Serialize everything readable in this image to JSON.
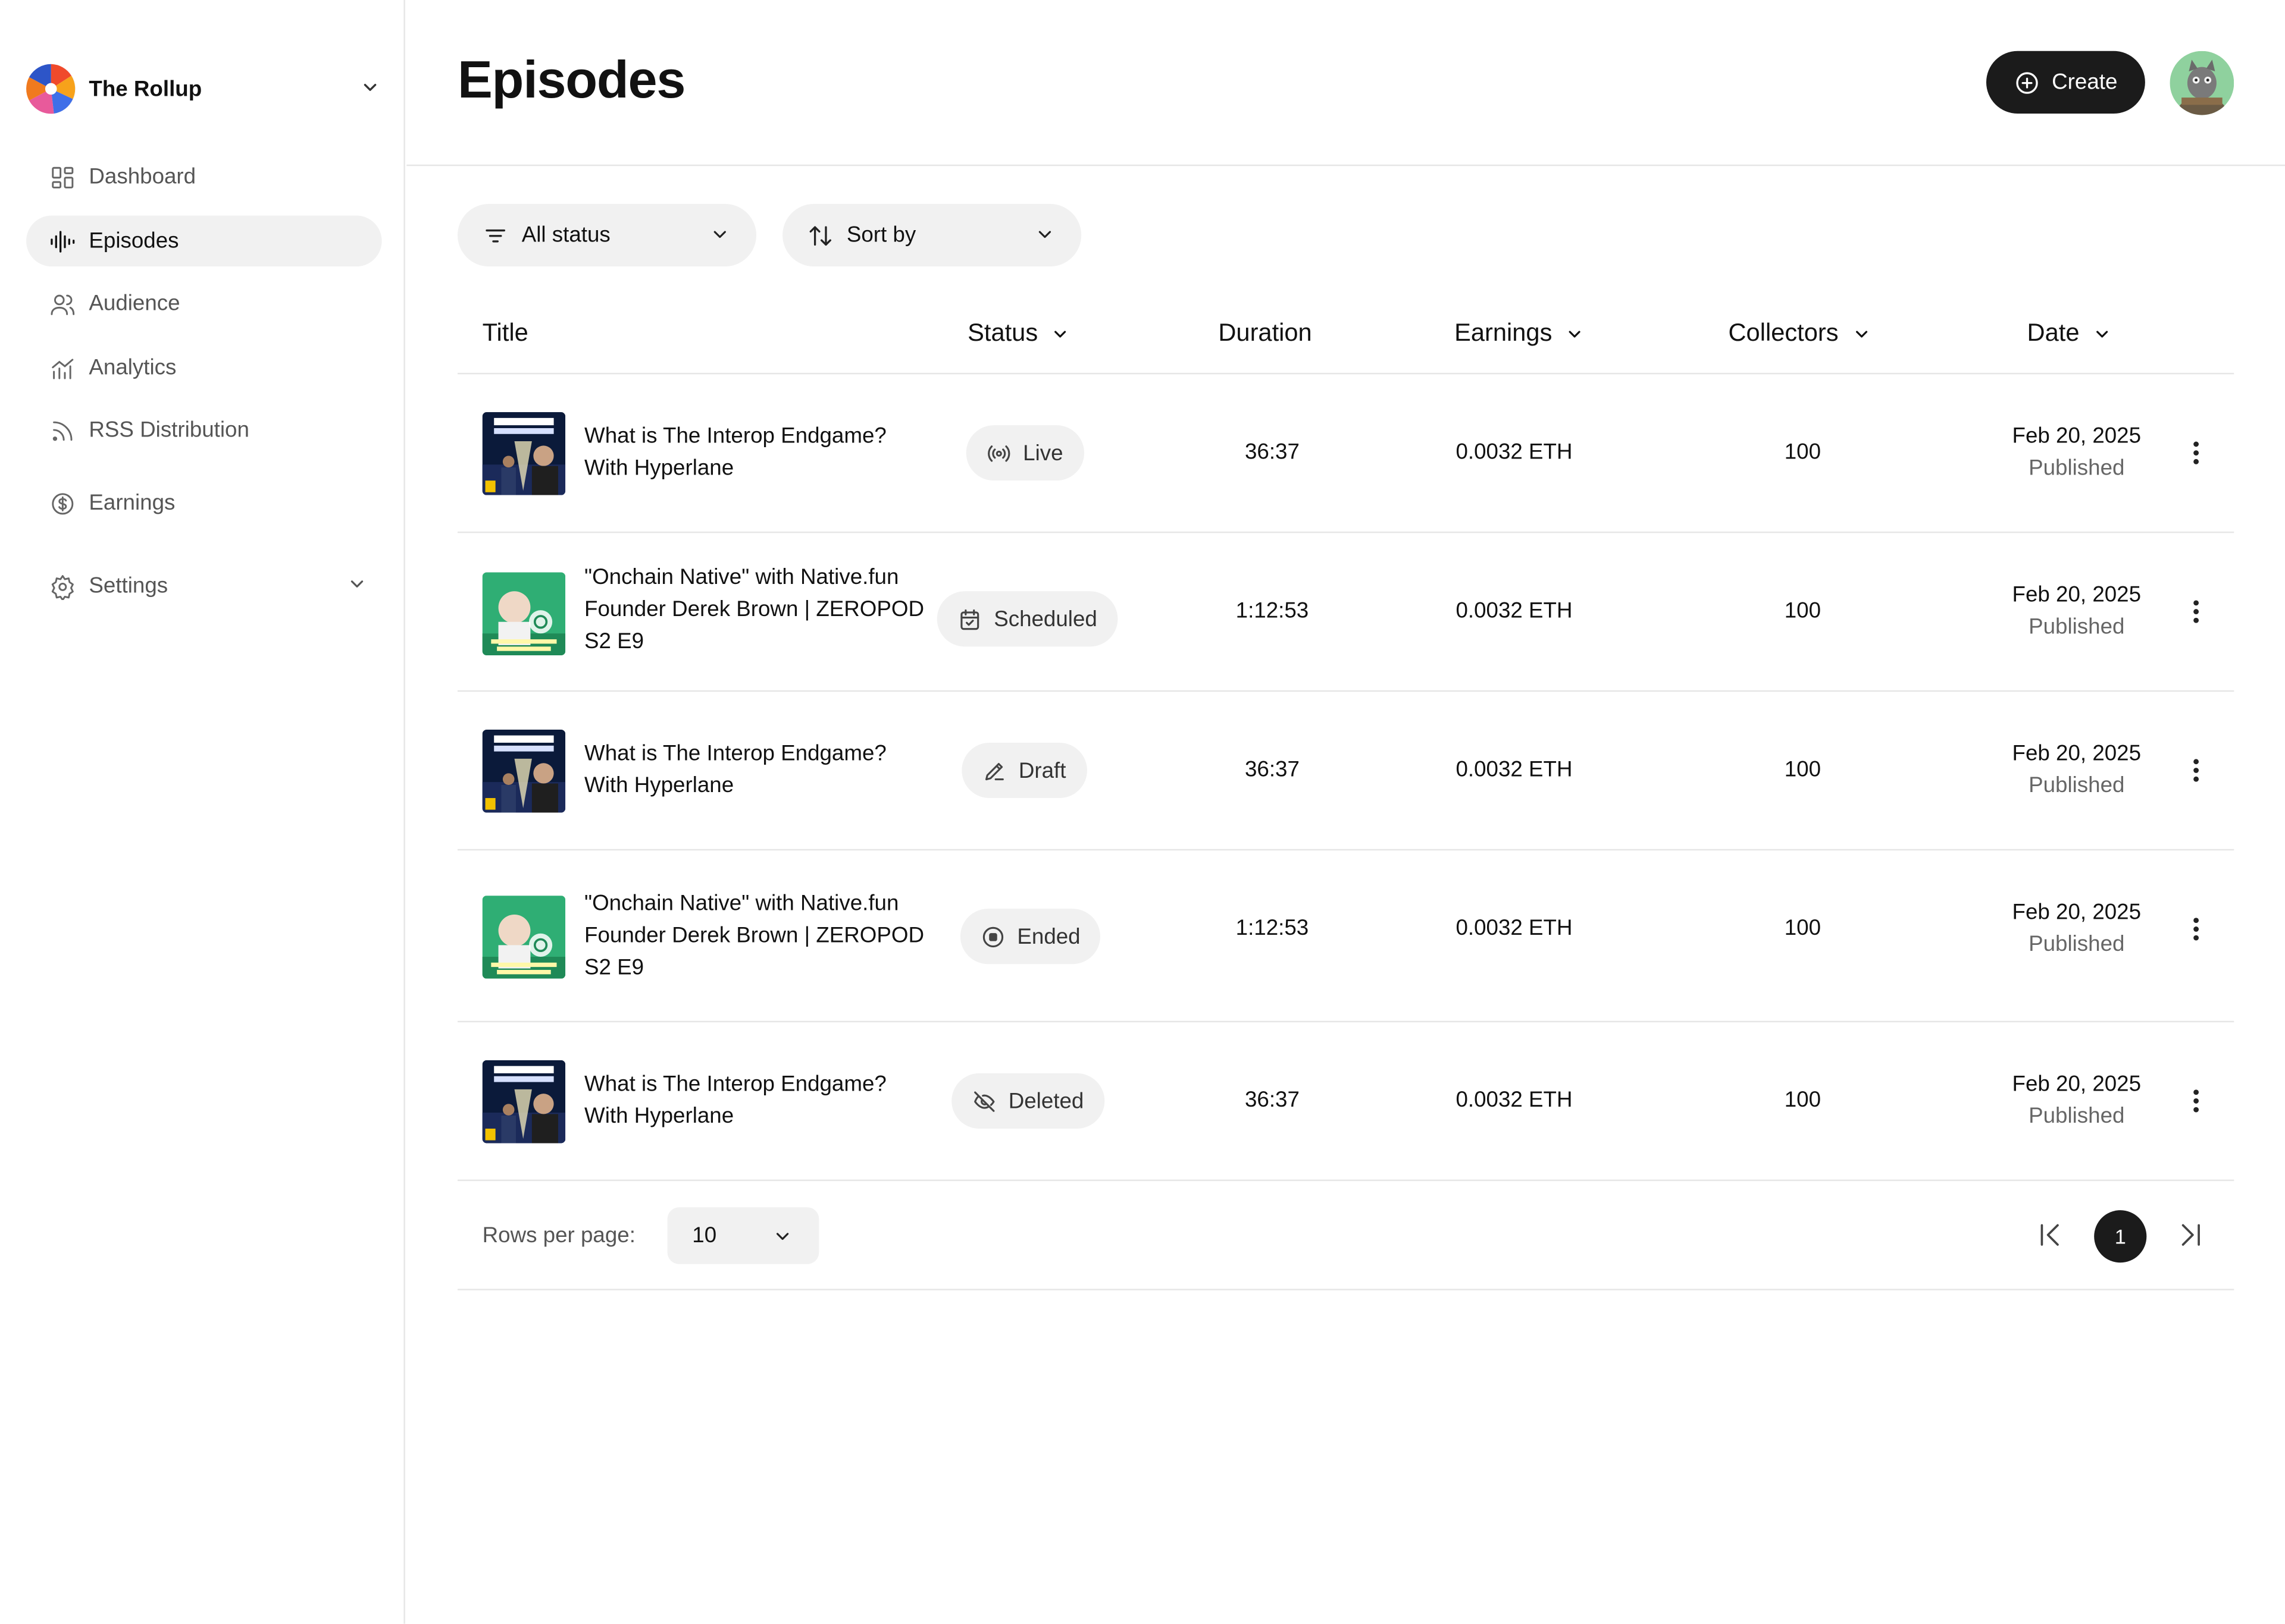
{
  "workspace": {
    "name": "The Rollup"
  },
  "sidebar": {
    "items": [
      {
        "label": "Dashboard",
        "icon": "dashboard-grid-icon"
      },
      {
        "label": "Episodes",
        "icon": "audio-waveform-icon"
      },
      {
        "label": "Audience",
        "icon": "users-icon"
      },
      {
        "label": "Analytics",
        "icon": "chart-bars-icon"
      },
      {
        "label": "RSS Distribution",
        "icon": "rss-icon"
      },
      {
        "label": "Earnings",
        "icon": "dollar-circle-icon"
      },
      {
        "label": "Settings",
        "icon": "gear-icon"
      }
    ]
  },
  "header": {
    "title": "Episodes",
    "create_label": "Create"
  },
  "filters": {
    "status": "All status",
    "sort": "Sort by"
  },
  "table": {
    "columns": [
      "Title",
      "Status",
      "Duration",
      "Earnings",
      "Collectors",
      "Date"
    ],
    "rows": [
      {
        "title": "What is The Interop Endgame? With Hyperlane",
        "thumb": "interop",
        "status": "Live",
        "status_icon": "broadcast-icon",
        "duration": "36:37",
        "earnings": "0.0032 ETH",
        "collectors": "100",
        "date": "Feb 20, 2025",
        "state": "Published"
      },
      {
        "title": "\"Onchain Native\" with Native.fun Founder Derek Brown | ZEROPOD S2 E9",
        "thumb": "zeropod",
        "status": "Scheduled",
        "status_icon": "calendar-check-icon",
        "duration": "1:12:53",
        "earnings": "0.0032 ETH",
        "collectors": "100",
        "date": "Feb 20, 2025",
        "state": "Published"
      },
      {
        "title": "What is The Interop Endgame? With Hyperlane",
        "thumb": "interop",
        "status": "Draft",
        "status_icon": "pencil-icon",
        "duration": "36:37",
        "earnings": "0.0032 ETH",
        "collectors": "100",
        "date": "Feb 20, 2025",
        "state": "Published"
      },
      {
        "title": "\"Onchain Native\" with Native.fun Founder Derek Brown | ZEROPOD S2 E9",
        "thumb": "zeropod",
        "status": "Ended",
        "status_icon": "stop-circle-icon",
        "duration": "1:12:53",
        "earnings": "0.0032 ETH",
        "collectors": "100",
        "date": "Feb 20, 2025",
        "state": "Published"
      },
      {
        "title": "What is The Interop Endgame? With Hyperlane",
        "thumb": "interop",
        "status": "Deleted",
        "status_icon": "eye-off-icon",
        "duration": "36:37",
        "earnings": "0.0032 ETH",
        "collectors": "100",
        "date": "Feb 20, 2025",
        "state": "Published"
      }
    ]
  },
  "pagination": {
    "rows_label": "Rows per page:",
    "rows_value": "10",
    "current_page": "1"
  },
  "colors": {
    "primary": "#1b1b1b",
    "pill_bg": "#f1f1f1",
    "divider": "#e6e6e6",
    "muted_text": "#666666"
  }
}
